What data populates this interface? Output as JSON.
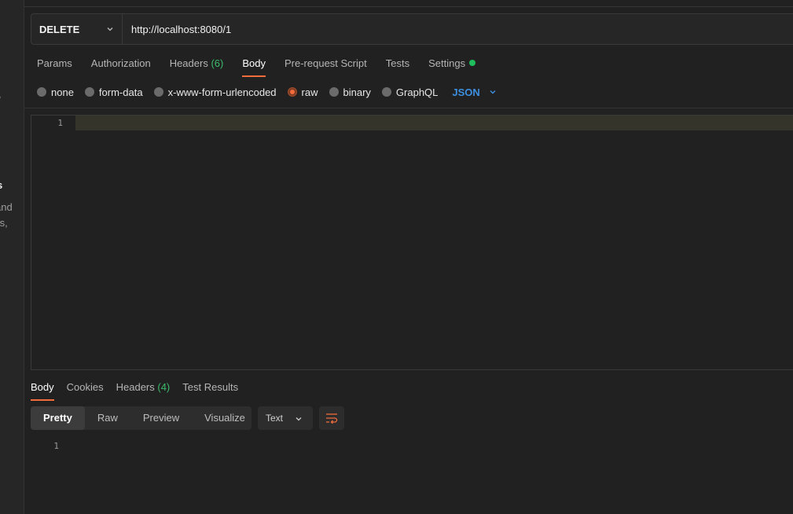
{
  "sidebar": {
    "fragments": [
      ",",
      "s",
      "and",
      "ts,"
    ]
  },
  "request": {
    "method": "DELETE",
    "url": "http://localhost:8080/1"
  },
  "request_tabs": [
    {
      "label": "Params",
      "count": ""
    },
    {
      "label": "Authorization",
      "count": ""
    },
    {
      "label": "Headers",
      "count": "(6)"
    },
    {
      "label": "Body",
      "count": "",
      "active": true
    },
    {
      "label": "Pre-request Script",
      "count": ""
    },
    {
      "label": "Tests",
      "count": ""
    },
    {
      "label": "Settings",
      "count": ""
    }
  ],
  "body_types": {
    "options": [
      "none",
      "form-data",
      "x-www-form-urlencoded",
      "raw",
      "binary",
      "GraphQL"
    ],
    "selected": "raw",
    "format": "JSON"
  },
  "editor": {
    "line_numbers": [
      "1"
    ]
  },
  "response_tabs": [
    {
      "label": "Body",
      "count": ""
    },
    {
      "label": "Cookies",
      "count": ""
    },
    {
      "label": "Headers",
      "count": "(4)"
    },
    {
      "label": "Test Results",
      "count": ""
    }
  ],
  "response_view": {
    "modes": [
      "Pretty",
      "Raw",
      "Preview",
      "Visualize"
    ],
    "selected": "Pretty",
    "language": "Text",
    "line_numbers": [
      "1"
    ]
  },
  "colors": {
    "accent": "#f26b3a",
    "link_blue": "#3d8fe0",
    "count_green": "#3dbb6d"
  }
}
